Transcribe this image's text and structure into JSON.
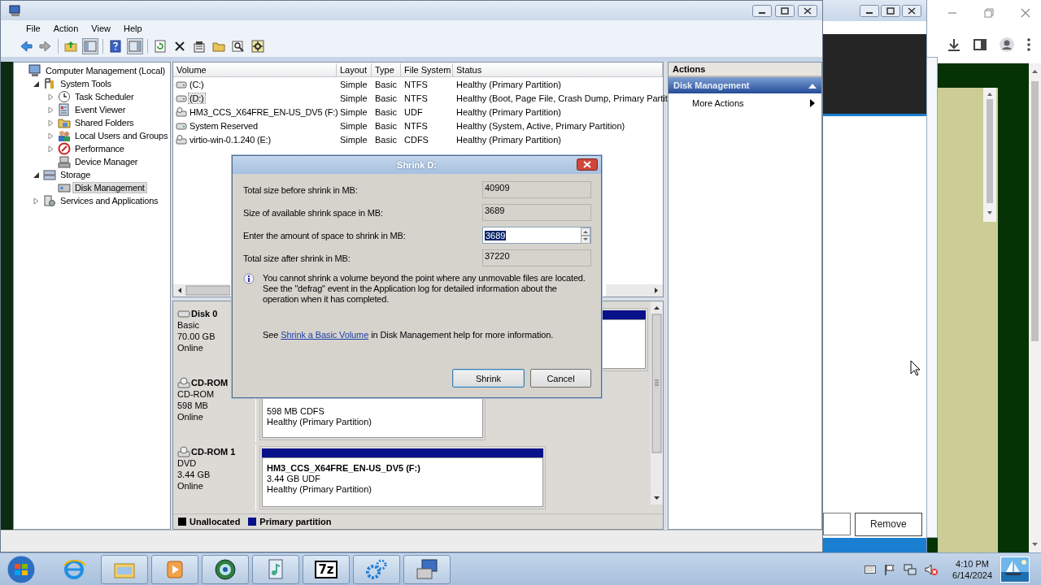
{
  "main_window": {
    "menu": [
      "File",
      "Action",
      "View",
      "Help"
    ],
    "tree": [
      {
        "label": "Computer Management (Local)",
        "selected": false,
        "children": [
          {
            "label": "System Tools",
            "expanded": true,
            "selected": false,
            "children": [
              {
                "label": "Task Scheduler",
                "expanded": false,
                "selected": false
              },
              {
                "label": "Event Viewer",
                "expanded": false,
                "selected": false
              },
              {
                "label": "Shared Folders",
                "expanded": false,
                "selected": false
              },
              {
                "label": "Local Users and Groups",
                "expanded": false,
                "selected": false
              },
              {
                "label": "Performance",
                "expanded": false,
                "selected": false
              },
              {
                "label": "Device Manager",
                "selected": false
              }
            ]
          },
          {
            "label": "Storage",
            "expanded": true,
            "selected": false,
            "children": [
              {
                "label": "Disk Management",
                "selected": true
              }
            ]
          },
          {
            "label": "Services and Applications",
            "expanded": false,
            "selected": false
          }
        ]
      }
    ],
    "volumes": {
      "columns": [
        "Volume",
        "Layout",
        "Type",
        "File System",
        "Status"
      ],
      "rows": [
        {
          "cells": [
            "(C:)",
            "Simple",
            "Basic",
            "NTFS",
            "Healthy (Primary Partition)"
          ],
          "selected": false
        },
        {
          "cells": [
            "(D:)",
            "Simple",
            "Basic",
            "NTFS",
            "Healthy (Boot, Page File, Crash Dump, Primary Partit"
          ],
          "selected": true
        },
        {
          "cells": [
            "HM3_CCS_X64FRE_EN-US_DV5 (F:)",
            "Simple",
            "Basic",
            "UDF",
            "Healthy (Primary Partition)"
          ],
          "selected": false
        },
        {
          "cells": [
            "System Reserved",
            "Simple",
            "Basic",
            "NTFS",
            "Healthy (System, Active, Primary Partition)"
          ],
          "selected": false
        },
        {
          "cells": [
            "virtio-win-0.1.240 (E:)",
            "Simple",
            "Basic",
            "CDFS",
            "Healthy (Primary Partition)"
          ],
          "selected": false
        }
      ]
    },
    "disks": [
      {
        "name": "Disk 0",
        "lines": [
          "Basic",
          "70.00 GB",
          "Online"
        ],
        "partitions": [
          {
            "kind": "primary"
          }
        ]
      },
      {
        "name": "CD-ROM",
        "lines": [
          "CD-ROM",
          "598 MB",
          "Online"
        ],
        "partitions": [
          {
            "lines": [
              "598 MB CDFS",
              "Healthy (Primary Partition)"
            ]
          }
        ]
      },
      {
        "name": "CD-ROM 1",
        "lines": [
          "DVD",
          "3.44 GB",
          "Online"
        ],
        "partitions": [
          {
            "kind": "primary",
            "title": "HM3_CCS_X64FRE_EN-US_DV5  (F:)",
            "lines": [
              "3.44 GB UDF",
              "Healthy (Primary Partition)"
            ]
          }
        ]
      }
    ],
    "legend": [
      {
        "label": "Unallocated",
        "kind": "unallocated"
      },
      {
        "label": "Primary partition",
        "kind": "primary"
      }
    ],
    "actions": {
      "title": "Actions",
      "section": "Disk Management",
      "items": [
        "More Actions"
      ]
    }
  },
  "dialog": {
    "title": "Shrink D:",
    "fields": [
      {
        "kind": "readonly",
        "label": "Total size before shrink in MB:",
        "value": "40909"
      },
      {
        "kind": "readonly",
        "label": "Size of available shrink space in MB:",
        "value": "3689"
      },
      {
        "kind": "spin",
        "label": "Enter the amount of space to shrink in MB:",
        "value": "3689",
        "text_selected": true
      },
      {
        "kind": "readonly",
        "label": "Total size after shrink in MB:",
        "value": "37220"
      }
    ],
    "info": "You cannot shrink a volume beyond the point where any unmovable files are located. See the \"defrag\" event in the Application log for detailed information about the operation when it has completed.",
    "help": {
      "before": "See ",
      "link": "Shrink a Basic Volume",
      "after": " in Disk Management help for more information."
    },
    "buttons": [
      {
        "label": "Shrink",
        "default": true
      },
      {
        "label": "Cancel",
        "default": false
      }
    ]
  },
  "background_window": {
    "button": "Remove"
  },
  "taskbar": {
    "apps": [
      {
        "open": false
      },
      {
        "open": true
      },
      {
        "open": true
      },
      {
        "open": true
      },
      {
        "open": true
      },
      {
        "open": true,
        "label": "7z"
      },
      {
        "open": true
      },
      {
        "open": true
      }
    ],
    "clock": {
      "time": "4:10 PM",
      "date": "6/14/2024"
    }
  }
}
